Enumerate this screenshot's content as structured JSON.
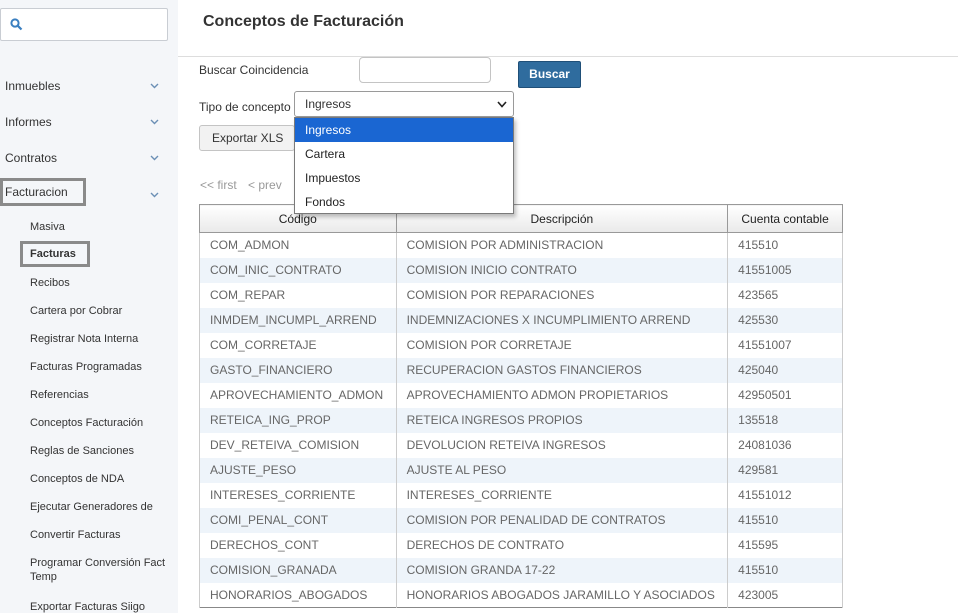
{
  "sidebar": {
    "menu": [
      {
        "label": "Inmuebles"
      },
      {
        "label": "Informes"
      },
      {
        "label": "Contratos"
      },
      {
        "label": "Facturacion"
      }
    ],
    "subitems": [
      "Masiva",
      "Facturas",
      "Recibos",
      "Cartera por Cobrar",
      "Registrar Nota Interna",
      "Facturas Programadas",
      "Referencias",
      "Conceptos Facturación",
      "Reglas de Sanciones",
      "Conceptos de NDA",
      "Ejecutar Generadores de",
      "Convertir Facturas",
      "Programar Conversión Fact Temp",
      "Exportar Facturas Siigo"
    ]
  },
  "main": {
    "title": "Conceptos de Facturación",
    "search_label": "Buscar Coincidencia",
    "search_value": "",
    "search_button": "Buscar",
    "type_label": "Tipo de concepto",
    "type_selected": "Ingresos",
    "type_options": [
      "Ingresos",
      "Cartera",
      "Impuestos",
      "Fondos"
    ],
    "export_button": "Exportar XLS",
    "pager": {
      "first": "<< first",
      "prev": "< prev"
    }
  },
  "table": {
    "headers": [
      "Código",
      "Descripción",
      "Cuenta contable"
    ],
    "rows": [
      [
        "COM_ADMON",
        "COMISION POR ADMINISTRACION",
        "415510"
      ],
      [
        "COM_INIC_CONTRATO",
        "COMISION INICIO CONTRATO",
        "41551005"
      ],
      [
        "COM_REPAR",
        "COMISION POR REPARACIONES",
        "423565"
      ],
      [
        "INMDEM_INCUMPL_ARREND",
        "INDEMNIZACIONES X INCUMPLIMIENTO ARREND",
        "425530"
      ],
      [
        "COM_CORRETAJE",
        "COMISION POR CORRETAJE",
        "41551007"
      ],
      [
        "GASTO_FINANCIERO",
        "RECUPERACION GASTOS FINANCIEROS",
        "425040"
      ],
      [
        "APROVECHAMIENTO_ADMON",
        "APROVECHAMIENTO ADMON PROPIETARIOS",
        "42950501"
      ],
      [
        "RETEICA_ING_PROP",
        "RETEICA INGRESOS PROPIOS",
        "135518"
      ],
      [
        "DEV_RETEIVA_COMISION",
        "DEVOLUCION RETEIVA INGRESOS",
        "24081036"
      ],
      [
        "AJUSTE_PESO",
        "AJUSTE AL PESO",
        "429581"
      ],
      [
        "INTERESES_CORRIENTE",
        "INTERESES_CORRIENTE",
        "41551012"
      ],
      [
        "COMI_PENAL_CONT",
        "COMISION POR PENALIDAD DE CONTRATOS",
        "415510"
      ],
      [
        "DERECHOS_CONT",
        "DERECHOS DE CONTRATO",
        "415595"
      ],
      [
        "COMISION_GRANADA",
        "COMISION GRANDA 17-22",
        "415510"
      ],
      [
        "HONORARIOS_ABOGADOS",
        "HONORARIOS ABOGADOS JARAMILLO Y ASOCIADOS",
        "423005"
      ]
    ]
  }
}
